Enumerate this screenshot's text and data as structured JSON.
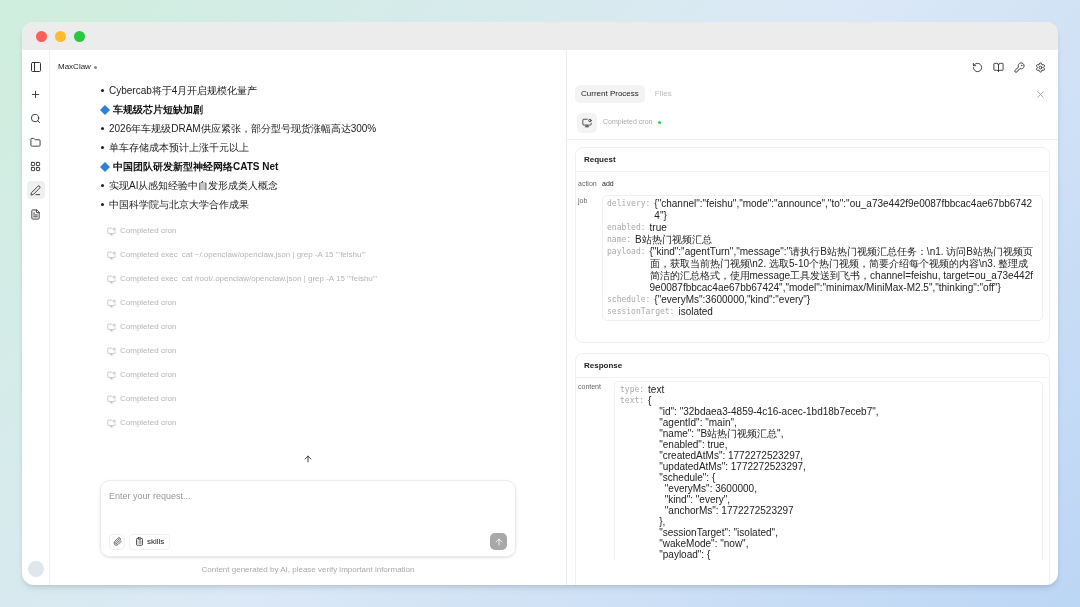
{
  "app": {
    "name": "MaxClaw",
    "online": true
  },
  "sidebar": {
    "items": [
      {
        "selected": false
      },
      {
        "selected": false
      },
      {
        "selected": false
      },
      {
        "selected": false
      },
      {
        "selected": true
      },
      {
        "selected": false
      }
    ]
  },
  "chat": {
    "messages": [
      {
        "kind": "bullet",
        "text": "Cybercab将于4月开启规模化量产"
      },
      {
        "kind": "heading",
        "text": "车规级芯片短缺加剧"
      },
      {
        "kind": "bullet",
        "text": "2026年车规级DRAM供应紧张，部分型号现货涨幅高达300%"
      },
      {
        "kind": "bullet",
        "text": "单车存储成本预计上涨千元以上"
      },
      {
        "kind": "heading",
        "text": "中国团队研发新型神经网络CATS Net"
      },
      {
        "kind": "bullet",
        "text": "实现AI从感知经验中自发形成类人概念"
      },
      {
        "kind": "bullet",
        "text": "中国科学院与北京大学合作成果"
      }
    ],
    "tool_calls": [
      {
        "label": "Completed cron"
      },
      {
        "label": "Completed exec",
        "command": "cat ~/.openclaw/openclaw.json | grep -A 15 '\"feishu\"'"
      },
      {
        "label": "Completed exec",
        "command": "cat /root/.openclaw/openclaw.json | grep -A 15 '\"feishu\"'"
      },
      {
        "label": "Completed cron"
      },
      {
        "label": "Completed cron"
      },
      {
        "label": "Completed cron"
      },
      {
        "label": "Completed cron"
      },
      {
        "label": "Completed cron"
      },
      {
        "label": "Completed cron"
      }
    ]
  },
  "composer": {
    "placeholder": "Enter your request...",
    "skills_label": "skills",
    "disclaimer": "Content generated by AI, please verify important information"
  },
  "panel": {
    "tabs": [
      {
        "label": "Current Process",
        "selected": true
      },
      {
        "label": "Files",
        "selected": false
      }
    ],
    "status": {
      "label": "Completed cron",
      "done": true
    },
    "request": {
      "title": "Request",
      "fields": [
        {
          "key": "action",
          "value": "add"
        },
        {
          "key": "job",
          "entries": [
            {
              "key": "delivery:",
              "value": "{\"channel\":\"feishu\",\"mode\":\"announce\",\"to\":\"ou_a73e442f9e0087fbbcac4ae67bb67424\"}"
            },
            {
              "key": "enabled:",
              "value": "true"
            },
            {
              "key": "name:",
              "value": "B站热门视频汇总"
            },
            {
              "key": "payload:",
              "value": "{\"kind\":\"agentTurn\",\"message\":\"请执行B站热门视频汇总任务：\\n1. 访问B站热门视频页面，获取当前热门视频\\n2. 选取5-10个热门视频，简要介绍每个视频的内容\\n3. 整理成简洁的汇总格式，使用message工具发送到飞书，channel=feishu, target=ou_a73e442f9e0087fbbcac4ae67bb67424\",\"model\":\"minimax/MiniMax-M2.5\",\"thinking\":\"off\"}"
            },
            {
              "key": "schedule:",
              "value": "{\"everyMs\":3600000,\"kind\":\"every\"}"
            },
            {
              "key": "sessionTarget:",
              "value": "isolated"
            }
          ]
        }
      ]
    },
    "response": {
      "title": "Response",
      "key": "content",
      "entries": [
        {
          "key": "type:",
          "value": "text"
        },
        {
          "key": "text:",
          "value": "{\n    \"id\": \"32bdaea3-4859-4c16-acec-1bd18b7eceb7\",\n    \"agentId\": \"main\",\n    \"name\": \"B站热门视频汇总\",\n    \"enabled\": true,\n    \"createdAtMs\": 1772272523297,\n    \"updatedAtMs\": 1772272523297,\n    \"schedule\": {\n      \"everyMs\": 3600000,\n      \"kind\": \"every\",\n      \"anchorMs\": 1772272523297\n    },\n    \"sessionTarget\": \"isolated\",\n    \"wakeMode\": \"now\",\n    \"payload\": {"
        }
      ]
    }
  }
}
